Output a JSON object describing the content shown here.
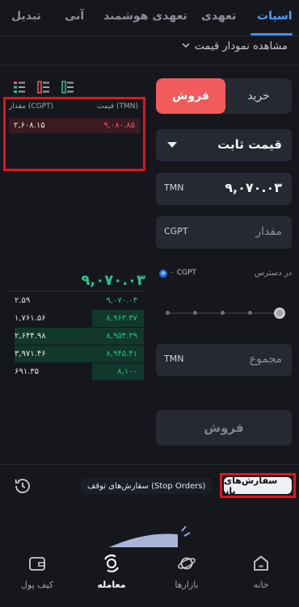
{
  "tabs": [
    {
      "label": "اسپات",
      "active": true
    },
    {
      "label": "تعهدی",
      "active": false
    },
    {
      "label": "تعهدی هوشمند",
      "active": false
    },
    {
      "label": "آنی",
      "active": false
    },
    {
      "label": "تبدیل",
      "active": false
    }
  ],
  "chart_toggle": {
    "label": "مشاهده نمودار قیمت",
    "icon": "chevron-down-icon"
  },
  "trade_form": {
    "buy_label": "خرید",
    "sell_label": "فروش",
    "order_type": "قیمت ثابت",
    "price": {
      "unit": "TMN",
      "value": "۹,۰۷۰.۰۳"
    },
    "amount": {
      "unit": "CGPT",
      "placeholder": "مقدار"
    },
    "available": {
      "label": "در دسترس",
      "value": "۰ CGPT"
    },
    "total": {
      "unit": "TMN",
      "placeholder": "مجموع"
    },
    "submit_label": "فروش",
    "slider_percent": 100
  },
  "order_book": {
    "header_price": "قیمت (TMN)",
    "header_amount": "مقدار (CGPT)",
    "asks": [
      {
        "price": "۹,۰۸۰.۸۵",
        "amount": "۲,۶۰۸.۱۵"
      }
    ],
    "last_price": "۹,۰۷۰.۰۳",
    "bids": [
      {
        "price": "۹,۰۷۰.۰۳",
        "amount": "۲.۵۹",
        "depth": 0
      },
      {
        "price": "۸,۹۶۳.۳۷",
        "amount": "۱,۷۶۱.۵۶",
        "depth": 0.38
      },
      {
        "price": "۸,۹۵۴.۳۹",
        "amount": "۲,۶۴۴.۹۸",
        "depth": 0.95
      },
      {
        "price": "۸,۹۴۵.۴۱",
        "amount": "۳,۹۷۱.۴۶",
        "depth": 0.95
      },
      {
        "price": "۸,۱۰۰",
        "amount": "۶۹۱.۳۵",
        "depth": 0.38
      }
    ]
  },
  "orders": {
    "open_label": "سفارش‌های باز",
    "stop_label": "سفارش‌های توقف (Stop Orders)"
  },
  "bottom_nav": [
    {
      "label": "خانه",
      "icon": "home-icon",
      "active": false
    },
    {
      "label": "بازارها",
      "icon": "planet-icon",
      "active": false
    },
    {
      "label": "معامله",
      "icon": "trade-icon",
      "active": true
    },
    {
      "label": "کیف پول",
      "icon": "wallet-icon",
      "active": false
    }
  ],
  "colors": {
    "accent": "#3d8ef8",
    "sell": "#f25b5b",
    "buy": "#27c48a",
    "highlight": "#e0141b"
  }
}
